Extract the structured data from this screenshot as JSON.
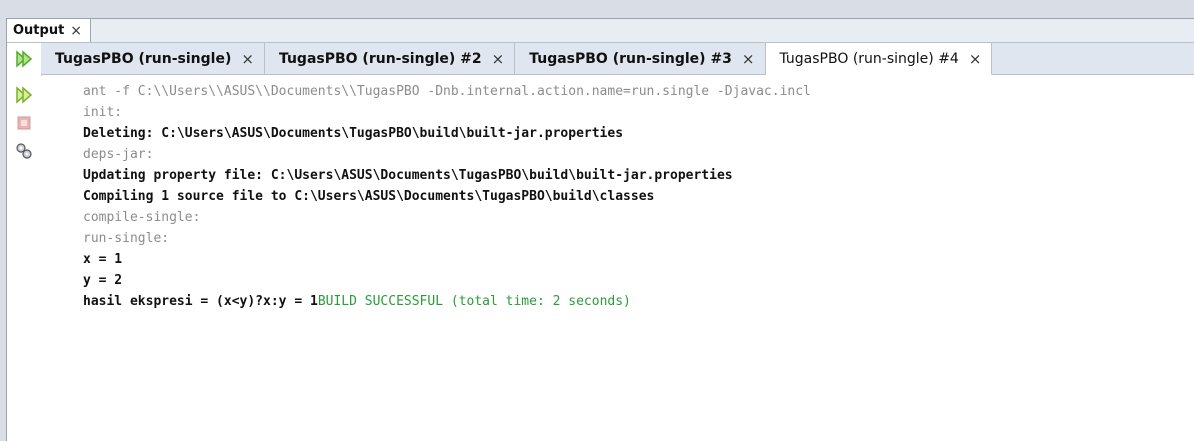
{
  "output_tab": {
    "label": "Output",
    "close": "×"
  },
  "run_tabs": [
    {
      "label": "TugasPBO (run-single)",
      "close": "×"
    },
    {
      "label": "TugasPBO (run-single) #2",
      "close": "×"
    },
    {
      "label": "TugasPBO (run-single) #3",
      "close": "×"
    },
    {
      "label": "TugasPBO (run-single) #4",
      "close": "×"
    }
  ],
  "console": {
    "lines": [
      "ant -f C:\\\\Users\\\\ASUS\\\\Documents\\\\TugasPBO -Dnb.internal.action.name=run.single -Djavac.incl",
      "init:",
      "Deleting: C:\\Users\\ASUS\\Documents\\TugasPBO\\build\\built-jar.properties",
      "deps-jar:",
      "Updating property file: C:\\Users\\ASUS\\Documents\\TugasPBO\\build\\built-jar.properties",
      "Compiling 1 source file to C:\\Users\\ASUS\\Documents\\TugasPBO\\build\\classes",
      "compile-single:",
      "run-single:",
      "x = 1",
      "y = 2",
      "hasil ekspresi = (x<y)?x:y = 1"
    ],
    "build_result": "BUILD SUCCESSFUL (total time: 2 seconds)"
  },
  "colors": {
    "gray_text": "#8c8c8c",
    "green_text": "#2a9b3a",
    "run_icon": "#4caf2a"
  },
  "gutter_icons": [
    "rerun-icon",
    "rerun-with-params-icon",
    "stop-icon",
    "settings-icon"
  ]
}
